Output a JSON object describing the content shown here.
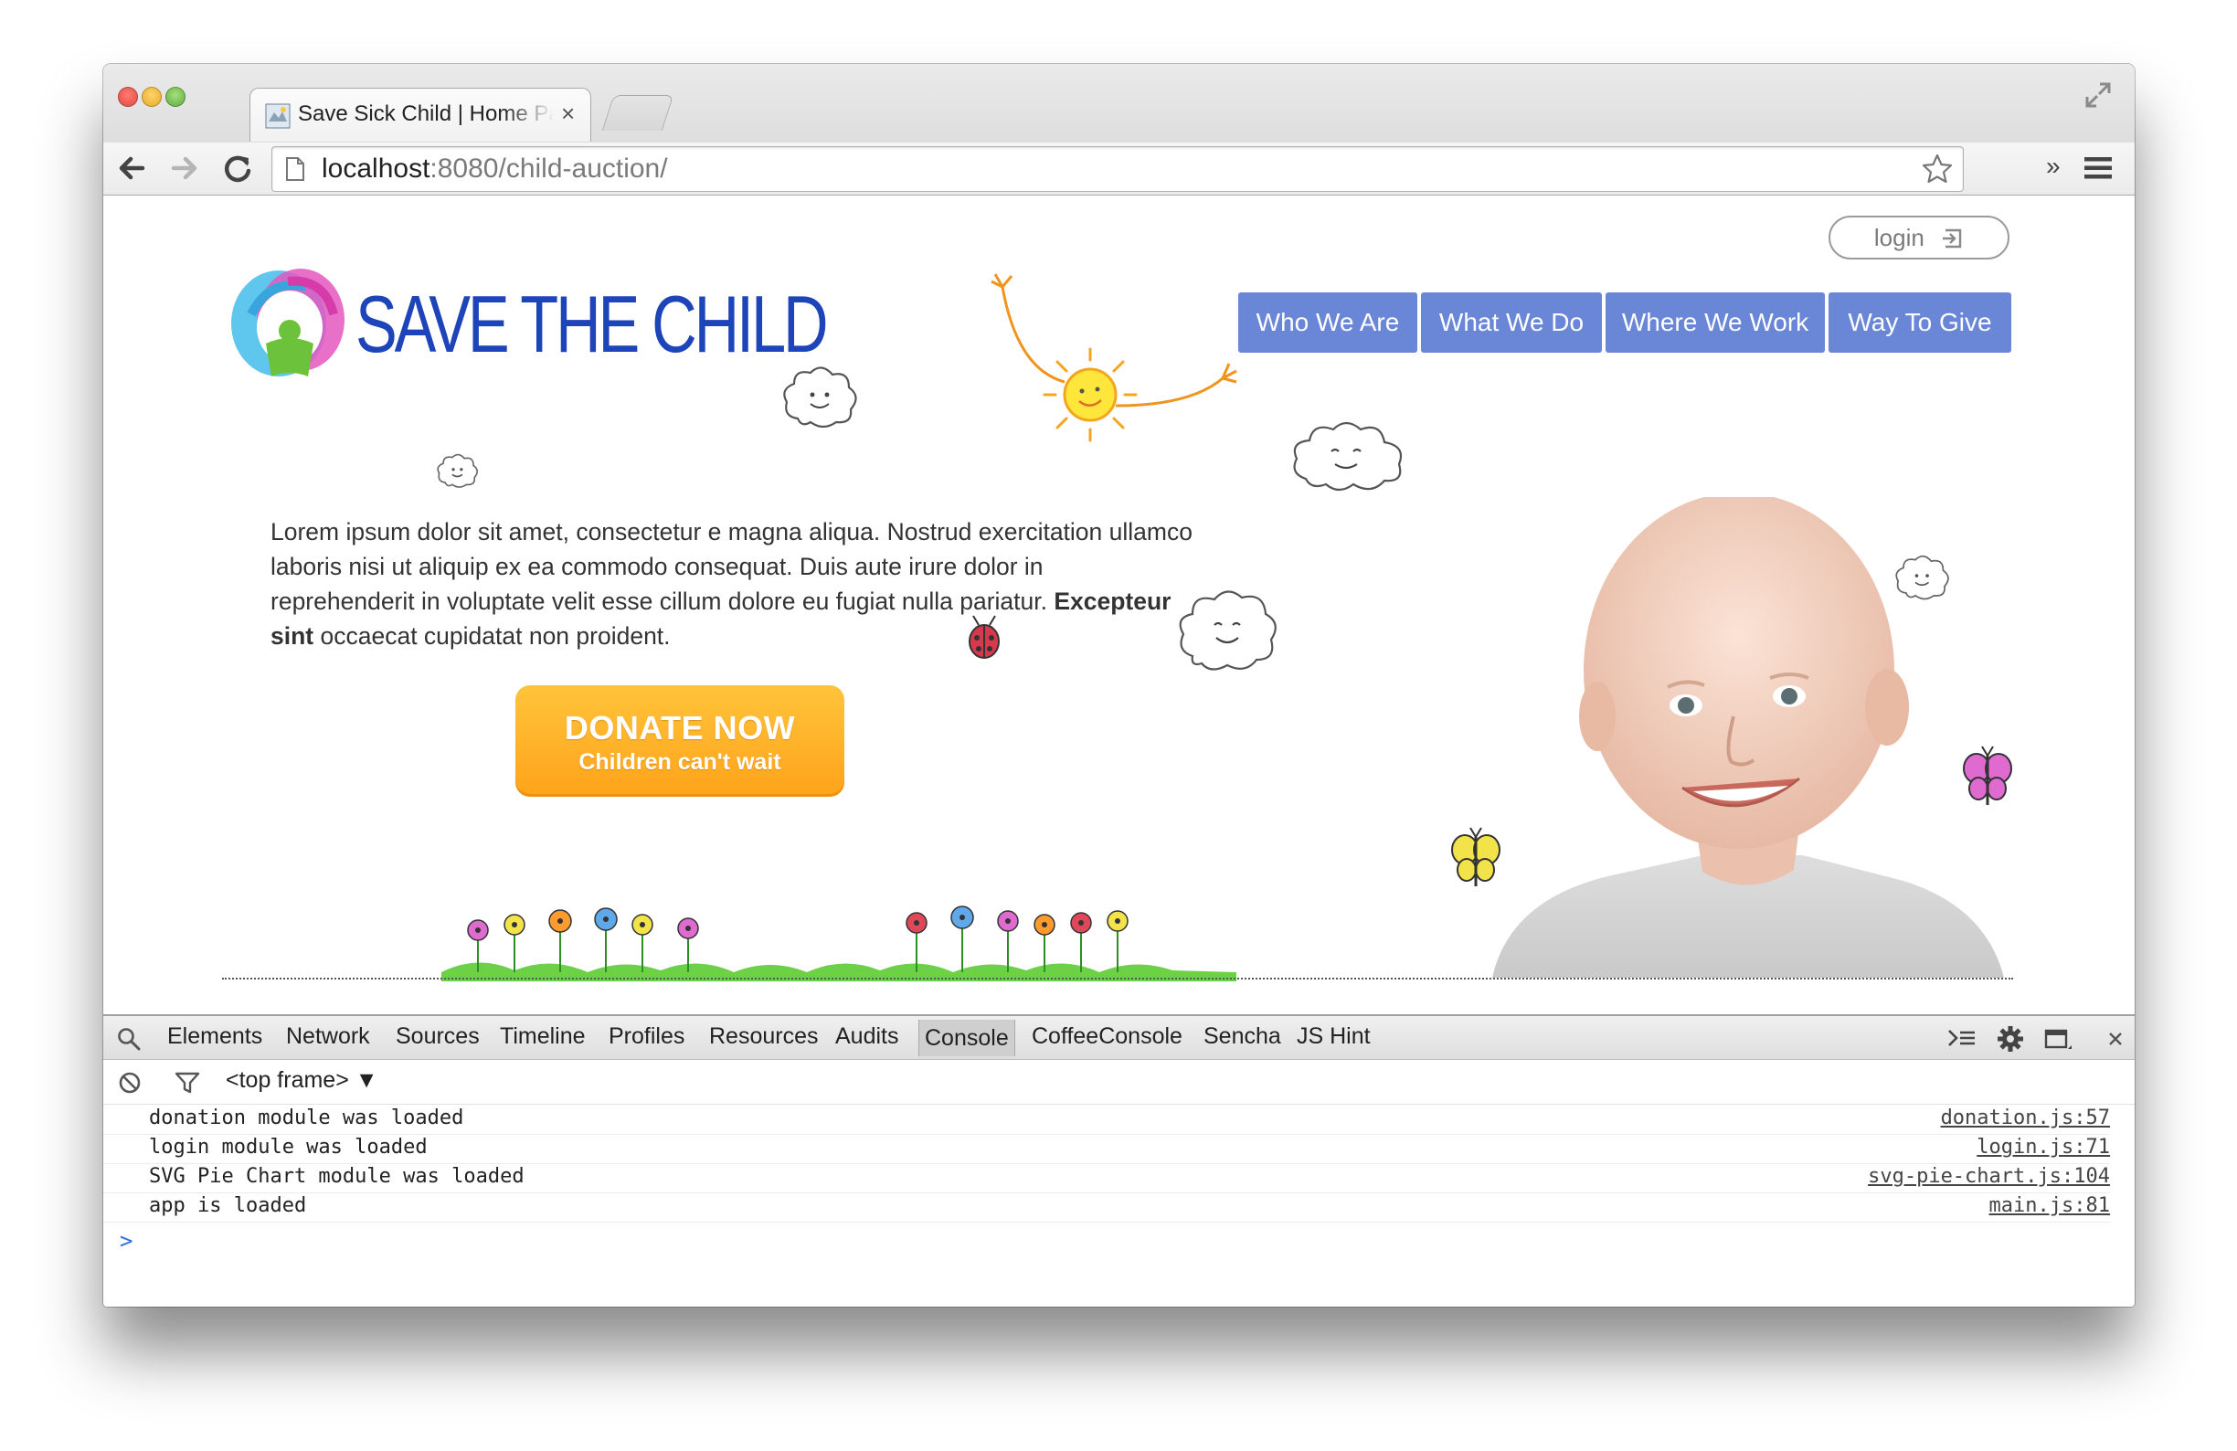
{
  "browser": {
    "tab_title": "Save Sick Child | Home Page",
    "tab_close": "×",
    "url_host": "localhost",
    "url_rest": ":8080/child-auction/",
    "ext_more": "»"
  },
  "site": {
    "login_label": "login",
    "logo_text": "SAVE THE CHILD",
    "nav": [
      "Who We Are",
      "What We Do",
      "Where We Work",
      "Way To Give"
    ],
    "intro_text": "Lorem ipsum dolor sit amet, consectetur e magna aliqua. Nostrud exercitation ullamco laboris nisi ut aliquip ex ea commodo consequat. Duis aute irure dolor in reprehenderit in voluptate velit esse cillum dolore eu fugiat nulla pariatur.",
    "intro_bold": "Excepteur sint",
    "intro_end": " occaecat cupidatat non proident.",
    "donate_title": "DONATE NOW",
    "donate_sub": "Children can't wait"
  },
  "devtools": {
    "tabs": [
      "Elements",
      "Network",
      "Sources",
      "Timeline",
      "Profiles",
      "Resources",
      "Audits",
      "Console",
      "CoffeeConsole",
      "Sencha",
      "JS Hint"
    ],
    "active_tab": "Console",
    "frame_selector": "<top frame> ▼",
    "logs": [
      {
        "msg": "donation module was loaded",
        "src": "donation.js:57"
      },
      {
        "msg": "login module was loaded",
        "src": "login.js:71"
      },
      {
        "msg": "SVG Pie Chart module was loaded",
        "src": "svg-pie-chart.js:104"
      },
      {
        "msg": "app is loaded",
        "src": "main.js:81"
      }
    ],
    "prompt": ">"
  },
  "colors": {
    "nav_bg": "#6a86d6",
    "logo_blue": "#1d44b8",
    "donate_orange": "#ffa31a"
  }
}
